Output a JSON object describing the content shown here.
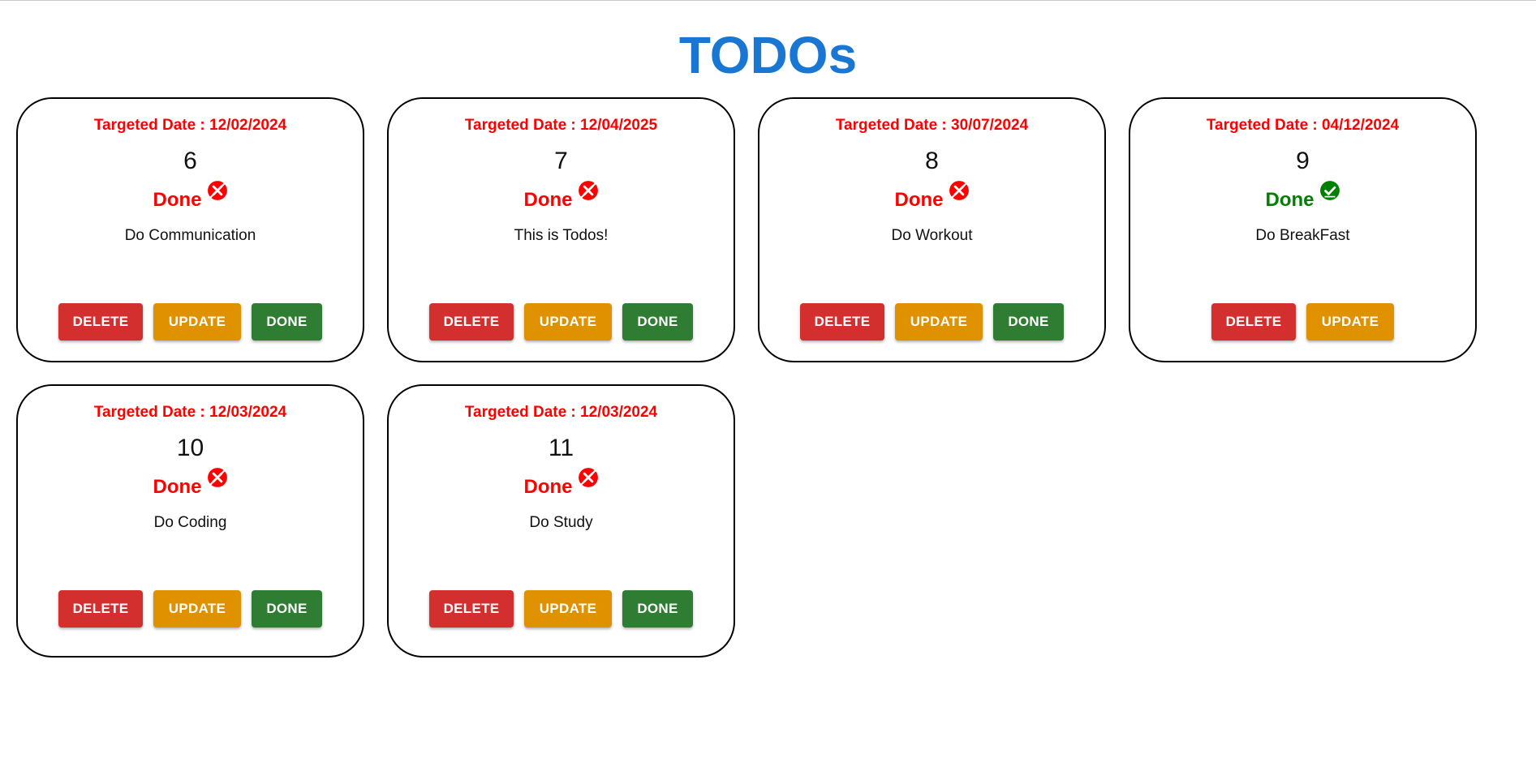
{
  "page": {
    "title": "TODOs"
  },
  "colors": {
    "title": "#1976d2",
    "date": "#ff0000",
    "not_done": "#ff0000",
    "done": "#008000",
    "delete": "#d32f2f",
    "update": "#e09100",
    "done_button": "#2e7d32"
  },
  "todos": [
    {
      "date_label": "Targeted Date : 12/02/2024",
      "id": "6",
      "status_label": "Done",
      "completed": false,
      "status_icon": "cancel-icon",
      "description": "Do Communication",
      "delete_label": "DELETE",
      "update_label": "UPDATE",
      "done_label": "DONE"
    },
    {
      "date_label": "Targeted Date : 12/04/2025",
      "id": "7",
      "status_label": "Done",
      "completed": false,
      "status_icon": "cancel-icon",
      "description": "This is Todos!",
      "delete_label": "DELETE",
      "update_label": "UPDATE",
      "done_label": "DONE"
    },
    {
      "date_label": "Targeted Date : 30/07/2024",
      "id": "8",
      "status_label": "Done",
      "completed": false,
      "status_icon": "cancel-icon",
      "description": "Do Workout",
      "delete_label": "DELETE",
      "update_label": "UPDATE",
      "done_label": "DONE"
    },
    {
      "date_label": "Targeted Date : 04/12/2024",
      "id": "9",
      "status_label": "Done",
      "completed": true,
      "status_icon": "check-circle-icon",
      "description": "Do BreakFast",
      "delete_label": "DELETE",
      "update_label": "UPDATE"
    },
    {
      "date_label": "Targeted Date : 12/03/2024",
      "id": "10",
      "status_label": "Done",
      "completed": false,
      "status_icon": "cancel-icon",
      "description": "Do Coding",
      "delete_label": "DELETE",
      "update_label": "UPDATE",
      "done_label": "DONE"
    },
    {
      "date_label": "Targeted Date : 12/03/2024",
      "id": "11",
      "status_label": "Done",
      "completed": false,
      "status_icon": "cancel-icon",
      "description": "Do Study",
      "delete_label": "DELETE",
      "update_label": "UPDATE",
      "done_label": "DONE"
    }
  ]
}
